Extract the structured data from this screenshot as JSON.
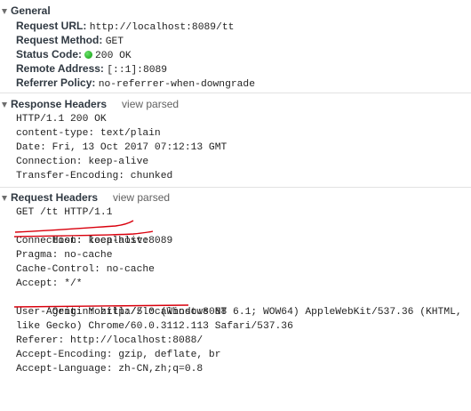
{
  "general": {
    "title": "General",
    "rows": [
      {
        "label": "Request URL:",
        "value": "http://localhost:8089/tt"
      },
      {
        "label": "Request Method:",
        "value": "GET"
      },
      {
        "label": "Status Code:",
        "value": "200 OK"
      },
      {
        "label": "Remote Address:",
        "value": "[::1]:8089"
      },
      {
        "label": "Referrer Policy:",
        "value": "no-referrer-when-downgrade"
      }
    ]
  },
  "response_headers": {
    "title": "Response Headers",
    "view_parsed": "view parsed",
    "lines": [
      "HTTP/1.1 200 OK",
      "content-type: text/plain",
      "Date: Fri, 13 Oct 2017 07:12:13 GMT",
      "Connection: keep-alive",
      "Transfer-Encoding: chunked"
    ]
  },
  "request_headers": {
    "title": "Request Headers",
    "view_parsed": "view parsed",
    "lines": [
      "GET /tt HTTP/1.1",
      "Host: localhost:8089",
      "Connection: keep-alive",
      "Pragma: no-cache",
      "Cache-Control: no-cache",
      "Accept: */*",
      "Origin: http://localhost:8088",
      "User-Agent: Mozilla/5.0 (Windows NT 6.1; WOW64) AppleWebKit/537.36 (KHTML, like Gecko) Chrome/60.0.3112.113 Safari/537.36",
      "Referer: http://localhost:8088/",
      "Accept-Encoding: gzip, deflate, br",
      "Accept-Language: zh-CN,zh;q=0.8"
    ]
  },
  "colors": {
    "status_dot": "#1aa31a",
    "annotation": "#d9000d"
  }
}
